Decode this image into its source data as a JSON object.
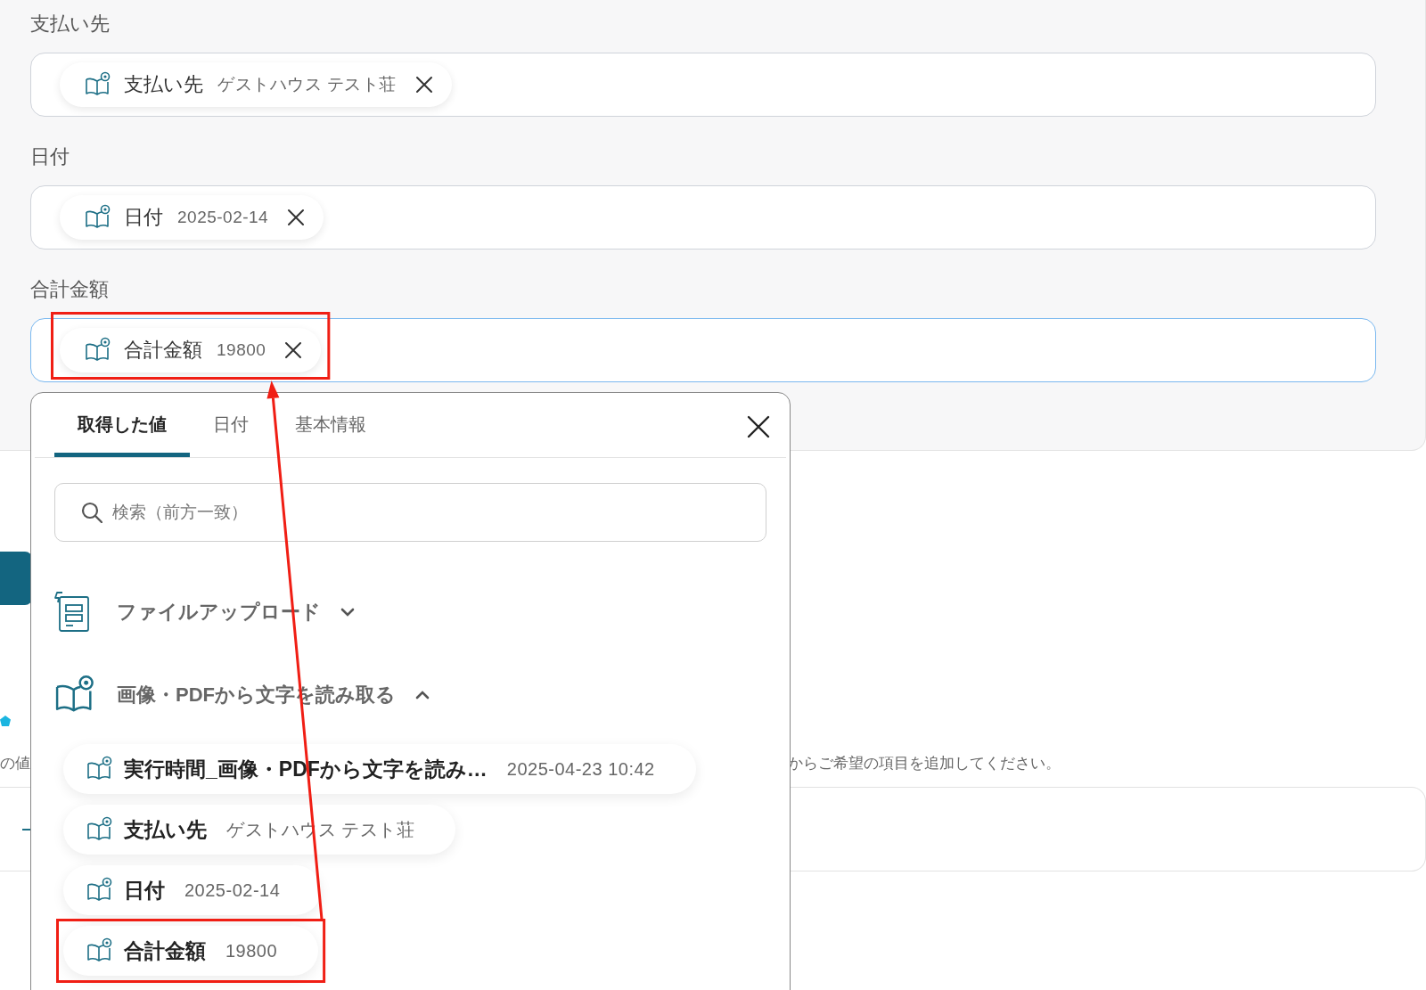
{
  "fields": [
    {
      "label": "支払い先",
      "focused": false,
      "chips": [
        {
          "name": "支払い先",
          "value": "ゲストハウス テスト荘",
          "highlighted": false
        }
      ]
    },
    {
      "label": "日付",
      "focused": false,
      "chips": [
        {
          "name": "日付",
          "value": "2025-02-14",
          "highlighted": false
        }
      ]
    },
    {
      "label": "合計金額",
      "focused": true,
      "chips": [
        {
          "name": "合計金額",
          "value": "19800",
          "highlighted": true
        }
      ]
    }
  ],
  "background": {
    "hint_start": "の値",
    "hint_end": "からご希望の項目を追加してください。"
  },
  "picker": {
    "tabs": [
      {
        "label": "取得した値",
        "selected": true
      },
      {
        "label": "日付",
        "selected": false
      },
      {
        "label": "基本情報",
        "selected": false
      }
    ],
    "search": {
      "placeholder": "検索（前方一致）"
    },
    "groups": [
      {
        "kind": "upload",
        "title": "ファイルアップロード",
        "expanded": false
      },
      {
        "kind": "ocr",
        "title": "画像・PDFから文字を読み取る",
        "expanded": true,
        "items": [
          {
            "name": "実行時間_画像・PDFから文字を読み…",
            "value": "2025-04-23 10:42",
            "highlighted": false
          },
          {
            "name": "支払い先",
            "value": "ゲストハウス テスト荘",
            "highlighted": false
          },
          {
            "name": "日付",
            "value": "2025-02-14",
            "highlighted": false
          },
          {
            "name": "合計金額",
            "value": "19800",
            "highlighted": true
          }
        ]
      }
    ]
  }
}
